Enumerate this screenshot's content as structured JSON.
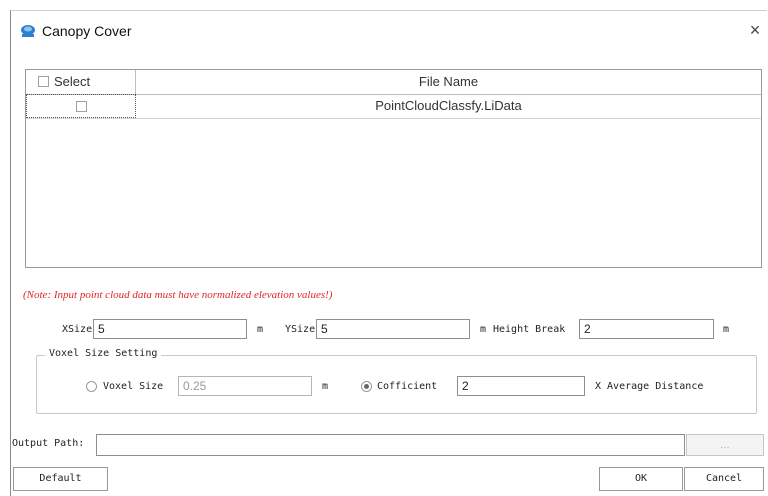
{
  "window": {
    "title": "Canopy Cover",
    "close_label": "×"
  },
  "table": {
    "header_select": "Select",
    "header_file": "File Name",
    "rows": [
      {
        "file": "PointCloudClassfy.LiData",
        "checked": false
      }
    ]
  },
  "note": "(Note: Input point cloud data must have normalized elevation values!)",
  "params": {
    "xsize_label": "XSize",
    "xsize_value": "5",
    "xsize_unit": "m",
    "ysize_label": "YSize",
    "ysize_value": "5",
    "ysize_unit": "m",
    "height_label": "Height Break",
    "height_value": "2",
    "height_unit": "m"
  },
  "voxel": {
    "group_title": "Voxel Size Setting",
    "voxel_label": "Voxel Size",
    "voxel_value": "0.25",
    "voxel_unit": "m",
    "voxel_selected": false,
    "coef_label": "Cofficient",
    "coef_value": "2",
    "coef_selected": true,
    "avg_label": "X Average Distance"
  },
  "output": {
    "label": "Output Path:",
    "value": "",
    "browse_label": "..."
  },
  "buttons": {
    "default": "Default",
    "ok": "OK",
    "cancel": "Cancel"
  }
}
